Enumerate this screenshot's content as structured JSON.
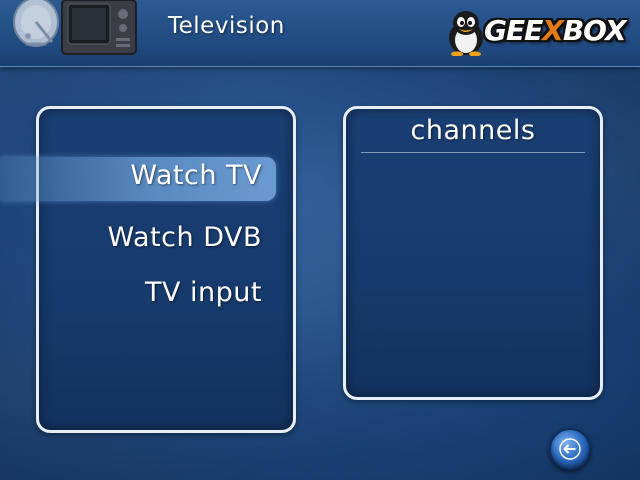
{
  "header": {
    "title": "Television",
    "image_icon": "tv-and-satellite-dish-icon",
    "logo": {
      "text_before": "GEE",
      "text_x": "X",
      "text_after": "BOX",
      "mascot_icon": "penguin-icon",
      "accent_color": "#e07a1a"
    }
  },
  "menu": {
    "items": [
      {
        "label": "Watch TV",
        "selected": true
      },
      {
        "label": "Watch DVB",
        "selected": false
      },
      {
        "label": "TV input",
        "selected": false
      }
    ]
  },
  "channels": {
    "title": "channels",
    "items": []
  },
  "back_button": {
    "icon": "arrow-left-icon"
  },
  "colors": {
    "background": "#1f4a82",
    "panel_border": "#e8eef7",
    "highlight": "#6ea5dc",
    "text": "#ffffff"
  }
}
